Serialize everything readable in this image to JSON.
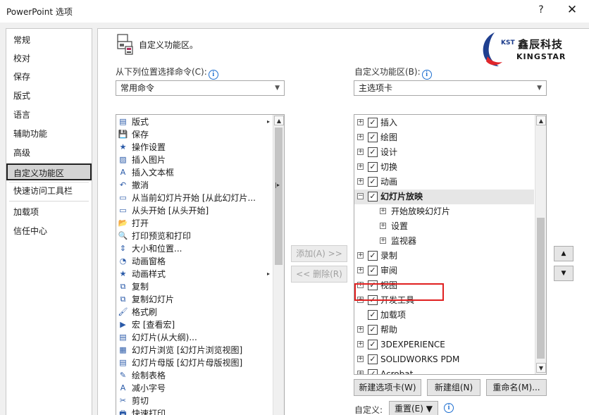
{
  "window": {
    "title": "PowerPoint 选项",
    "help": "?",
    "close": "✕"
  },
  "nav": {
    "items": [
      "常规",
      "校对",
      "保存",
      "版式",
      "语言",
      "辅助功能",
      "高级",
      "自定义功能区",
      "快速访问工具栏",
      "加载项",
      "信任中心"
    ],
    "selected": "自定义功能区"
  },
  "header": {
    "title": "自定义功能区。",
    "icon": "customize-ribbon-icon"
  },
  "logo": {
    "mark": "KST",
    "name_cn": "鑫辰科技",
    "name_en": "KINGSTAR"
  },
  "left": {
    "label": "从下列位置选择命令(C):",
    "combo_value": "常用命令",
    "commands": [
      {
        "icon": "layout-icon",
        "glyph": "▤",
        "label": "版式",
        "submenu": true
      },
      {
        "icon": "save-icon",
        "glyph": "💾",
        "label": "保存",
        "submenu": false
      },
      {
        "icon": "settings-icon",
        "glyph": "★",
        "label": "操作设置",
        "submenu": false
      },
      {
        "icon": "insert-picture-icon",
        "glyph": "▨",
        "label": "插入图片",
        "submenu": false
      },
      {
        "icon": "textbox-icon",
        "glyph": "A",
        "label": "插入文本框",
        "submenu": false
      },
      {
        "icon": "undo-icon",
        "glyph": "↶",
        "label": "撤消",
        "submenu": true
      },
      {
        "icon": "slideshow-current-icon",
        "glyph": "▭",
        "label": "从当前幻灯片开始 [从此幻灯片...",
        "submenu": false
      },
      {
        "icon": "slideshow-start-icon",
        "glyph": "▭",
        "label": "从头开始 [从头开始]",
        "submenu": false
      },
      {
        "icon": "open-folder-icon",
        "glyph": "📂",
        "label": "打开",
        "submenu": false
      },
      {
        "icon": "print-preview-icon",
        "glyph": "🔍",
        "label": "打印预览和打印",
        "submenu": false
      },
      {
        "icon": "size-position-icon",
        "glyph": "⇕",
        "label": "大小和位置...",
        "submenu": false
      },
      {
        "icon": "animation-pane-icon",
        "glyph": "◔",
        "label": "动画窗格",
        "submenu": false
      },
      {
        "icon": "animation-style-icon",
        "glyph": "★",
        "label": "动画样式",
        "submenu": true
      },
      {
        "icon": "copy-icon",
        "glyph": "⧉",
        "label": "复制",
        "submenu": false
      },
      {
        "icon": "duplicate-slide-icon",
        "glyph": "⧉",
        "label": "复制幻灯片",
        "submenu": false
      },
      {
        "icon": "format-painter-icon",
        "glyph": "🖌",
        "label": "格式刷",
        "submenu": false
      },
      {
        "icon": "macro-icon",
        "glyph": "▶",
        "label": "宏 [查看宏]",
        "submenu": false
      },
      {
        "icon": "outline-slides-icon",
        "glyph": "▤",
        "label": "幻灯片(从大纲)...",
        "submenu": false
      },
      {
        "icon": "slide-sorter-icon",
        "glyph": "▦",
        "label": "幻灯片浏览 [幻灯片浏览视图]",
        "submenu": false
      },
      {
        "icon": "slide-master-icon",
        "glyph": "▤",
        "label": "幻灯片母版 [幻灯片母版视图]",
        "submenu": false
      },
      {
        "icon": "draw-table-icon",
        "glyph": "✎",
        "label": "绘制表格",
        "submenu": false
      },
      {
        "icon": "decrease-font-icon",
        "glyph": "A",
        "label": "减小字号",
        "submenu": false
      },
      {
        "icon": "cut-icon",
        "glyph": "✂",
        "label": "剪切",
        "submenu": false
      },
      {
        "icon": "quick-print-icon",
        "glyph": "🖶",
        "label": "快速打印",
        "submenu": false
      }
    ]
  },
  "middle": {
    "add": "添加(A) >>",
    "remove": "<< 删除(R)"
  },
  "right": {
    "label": "自定义功能区(B):",
    "combo_value": "主选项卡",
    "tabs": [
      {
        "label": "插入",
        "level": 0,
        "expander": "+",
        "checked": true
      },
      {
        "label": "绘图",
        "level": 0,
        "expander": "+",
        "checked": true
      },
      {
        "label": "设计",
        "level": 0,
        "expander": "+",
        "checked": true
      },
      {
        "label": "切换",
        "level": 0,
        "expander": "+",
        "checked": true
      },
      {
        "label": "动画",
        "level": 0,
        "expander": "+",
        "checked": true
      },
      {
        "label": "幻灯片放映",
        "level": 0,
        "expander": "−",
        "checked": true,
        "highlight": true,
        "bold": true
      },
      {
        "label": "开始放映幻灯片",
        "level": 1,
        "expander": "+",
        "checked": null
      },
      {
        "label": "设置",
        "level": 1,
        "expander": "+",
        "checked": null
      },
      {
        "label": "监视器",
        "level": 1,
        "expander": "+",
        "checked": null
      },
      {
        "label": "录制",
        "level": 0,
        "expander": "+",
        "checked": true
      },
      {
        "label": "审阅",
        "level": 0,
        "expander": "+",
        "checked": true
      },
      {
        "label": "视图",
        "level": 0,
        "expander": "+",
        "checked": true
      },
      {
        "label": "开发工具",
        "level": 0,
        "expander": "+",
        "checked": true
      },
      {
        "label": "加载项",
        "level": 0,
        "expander": "",
        "checked": true
      },
      {
        "label": "帮助",
        "level": 0,
        "expander": "+",
        "checked": true
      },
      {
        "label": "3DEXPERIENCE",
        "level": 0,
        "expander": "+",
        "checked": true
      },
      {
        "label": "SOLIDWORKS PDM",
        "level": 0,
        "expander": "+",
        "checked": true
      },
      {
        "label": "Acrobat",
        "level": 0,
        "expander": "+",
        "checked": true
      }
    ]
  },
  "bottom": {
    "new_tab": "新建选项卡(W)",
    "new_group": "新建组(N)",
    "rename": "重命名(M)...",
    "customize_label": "自定义:",
    "reset": "重置(E) ▼"
  },
  "move": {
    "up": "▲",
    "down": "▼"
  },
  "colors": {
    "accent": "#1e6fd0",
    "highlight_box": "#e02020",
    "selected_nav": "#d4d4d4"
  }
}
